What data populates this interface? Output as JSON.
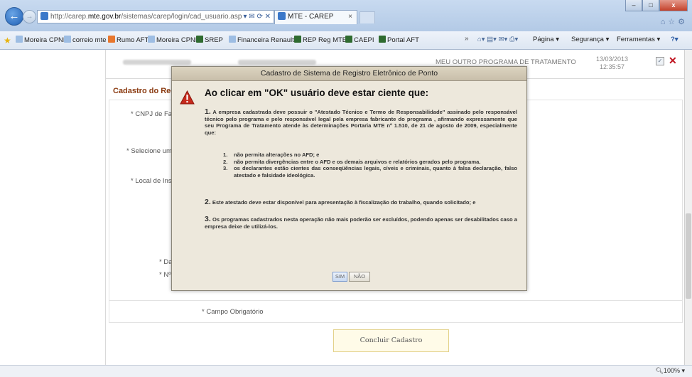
{
  "browser": {
    "url_prefix": "http://carep.",
    "url_domain": "mte.gov.br",
    "url_path": "/sistemas/carep/login/cad_usuario.asp",
    "address_tools": "▾ ✉ ⟳ ✕",
    "tab_title": "MTE - CAREP",
    "tab_close": "×",
    "window_minimize": "–",
    "window_maximize": "□",
    "window_close": "x"
  },
  "favorites": [
    {
      "label": "Moreira CPND",
      "color": "#9dbde3"
    },
    {
      "label": "correio mte",
      "color": "#9dbde3"
    },
    {
      "label": "Rumo AFT",
      "color": "#e8772e"
    },
    {
      "label": "Moreira CPND",
      "color": "#9dbde3"
    },
    {
      "label": "SREP",
      "color": "#2f6b30"
    },
    {
      "label": "Financeira Renault",
      "color": "#9dbde3"
    },
    {
      "label": "REP Reg MTE",
      "color": "#2f6b30"
    },
    {
      "label": "CAEPI",
      "color": "#2f6b30"
    },
    {
      "label": "Portal AFT",
      "color": "#2f6b30"
    }
  ],
  "command_bar": {
    "pagina": "Página ▾",
    "seguranca": "Segurança ▾",
    "ferramentas": "Ferramentas ▾"
  },
  "page": {
    "program_name": "MEU OUTRO PROGRAMA DE TRATAMENTO",
    "date": "13/03/2013",
    "time": "12:35:57",
    "section_title": "Cadastro do Reg",
    "labels": {
      "cnpj": "* CNPJ de Fab",
      "selecione": "* Selecione um r",
      "local": "* Local de Inst",
      "data": "* Data",
      "numero": "* Nº"
    },
    "required_note": "* Campo Obrigatório",
    "submit_label": "Concluir Cadastro"
  },
  "dialog": {
    "title": "Cadastro de Sistema de Registro Eletrônico de Ponto",
    "heading": "Ao clicar em \"OK\" usuário deve estar ciente que:",
    "p1_num": "1.",
    "p1_text": "A empresa cadastrada deve possuir o \"Atestado Técnico e Termo de Responsabilidade\" assinado pelo responsável técnico pelo programa e pelo responsável legal pela empresa fabricante do programa , afirmando expressamente que seu Programa de Tratamento atende às determinações Portaria MTE nº 1.510, de 21 de agosto de 2009, especialmente que:",
    "items": [
      {
        "n": "1.",
        "text": "não permita alterações no AFD; e"
      },
      {
        "n": "2.",
        "text": "não permita divergências entre o AFD e os demais arquivos e relatórios gerados pelo programa."
      },
      {
        "n": "3.",
        "text": "os declarantes estão cientes das conseqüências legais, cíveis e criminais, quanto à falsa declaração, falso atestado e falsidade ideológica."
      }
    ],
    "p2_num": "2.",
    "p2_text": "Este atestado deve estar disponível para apresentação à fiscalização do trabalho, quando solicitado; e",
    "p3_num": "3.",
    "p3_text": "Os programas cadastrados nesta operação não mais poderão ser excluídos, podendo apenas ser desabilitados caso a empresa deixe de utilizá-los.",
    "btn_yes": "SIM",
    "btn_no": "NÃO"
  },
  "status": {
    "zoom": "100%"
  }
}
